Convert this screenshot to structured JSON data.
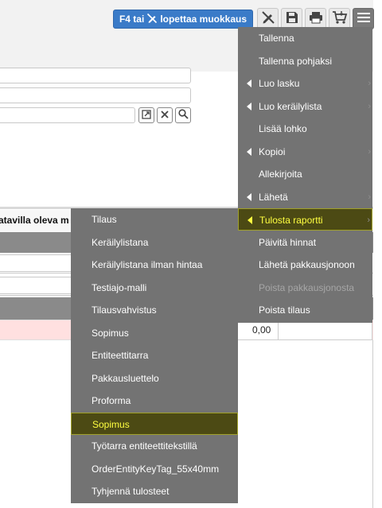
{
  "toolbar": {
    "edit_mode_button": {
      "prefix": "F4 tai",
      "suffix": "lopettaa muokkaus",
      "icon": "no-edit-icon"
    },
    "buttons": [
      {
        "name": "no-edit-button",
        "icon": "pencil-off-icon"
      },
      {
        "name": "save-button",
        "icon": "floppy-icon"
      },
      {
        "name": "print-button",
        "icon": "printer-icon"
      },
      {
        "name": "cart-button",
        "icon": "cart-icon"
      },
      {
        "name": "menu-button",
        "icon": "hamburger-icon"
      }
    ]
  },
  "table": {
    "title_fragment": "atavilla oleva m",
    "sum_value": "0,00"
  },
  "main_menu": {
    "items": [
      {
        "label": "Tallenna",
        "has_submenu": false
      },
      {
        "label": "Tallenna pohjaksi",
        "has_submenu": false
      },
      {
        "label": "Luo lasku",
        "has_submenu": true
      },
      {
        "label": "Luo keräilylista",
        "has_submenu": true
      },
      {
        "label": "Lisää lohko",
        "has_submenu": false
      },
      {
        "label": "Kopioi",
        "has_submenu": true
      },
      {
        "label": "Allekirjoita",
        "has_submenu": false
      },
      {
        "label": "Lähetä",
        "has_submenu": true
      },
      {
        "label": "Tulosta raportti",
        "has_submenu": true,
        "selected": true
      },
      {
        "label": "Päivitä hinnat",
        "has_submenu": false
      },
      {
        "label": "Lähetä pakkausjonoon",
        "has_submenu": false
      },
      {
        "label": "Poista pakkausjonosta",
        "has_submenu": false,
        "disabled": true
      },
      {
        "label": "Poista tilaus",
        "has_submenu": false
      }
    ]
  },
  "report_submenu": {
    "items": [
      {
        "label": "Tilaus"
      },
      {
        "label": "Keräilylistana"
      },
      {
        "label": "Keräilylistana ilman hintaa"
      },
      {
        "label": "Testiajo-malli"
      },
      {
        "label": "Tilausvahvistus"
      },
      {
        "label": "Sopimus"
      },
      {
        "label": "Entiteettitarra"
      },
      {
        "label": "Pakkausluettelo"
      },
      {
        "label": "Proforma"
      },
      {
        "label": "Sopimus",
        "selected": true
      },
      {
        "label": "Työtarra entiteettitekstillä"
      },
      {
        "label": "OrderEntityKeyTag_55x40mm"
      },
      {
        "label": "Tyhjennä tulosteet"
      }
    ]
  },
  "colors": {
    "accent": "#3a7bc8",
    "menu_bg": "#737373",
    "selected_bg": "#4c4a14",
    "selected_text": "#ffff40",
    "error_row": "#ffe0e0"
  }
}
